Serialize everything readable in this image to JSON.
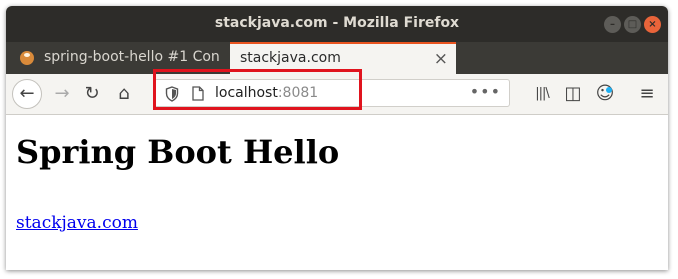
{
  "window": {
    "title": "stackjava.com - Mozilla Firefox",
    "buttons": {
      "minimize": "–",
      "maximize": "□",
      "close": "×"
    }
  },
  "tabs": [
    {
      "label": "spring-boot-hello #1 Con",
      "active": false,
      "close": "×"
    },
    {
      "label": "stackjava.com",
      "active": true,
      "close": "×"
    }
  ],
  "tabstrip": {
    "new_tab": "+"
  },
  "navbar": {
    "back": "←",
    "forward": "→",
    "reload": "↻",
    "home": "⌂",
    "library": "|||\\",
    "sidebar": "◫",
    "account": "☺",
    "menu": "≡"
  },
  "urlbar": {
    "host": "localhost",
    "port": ":8081",
    "page_actions": "•••"
  },
  "page": {
    "heading": "Spring Boot Hello",
    "link_text": "stackjava.com"
  },
  "colors": {
    "titlebar": "#2d2c29",
    "close_button": "#e9643a",
    "active_tab_accent": "#e95420",
    "highlight_box": "#e0141e",
    "link": "#0000ee"
  }
}
